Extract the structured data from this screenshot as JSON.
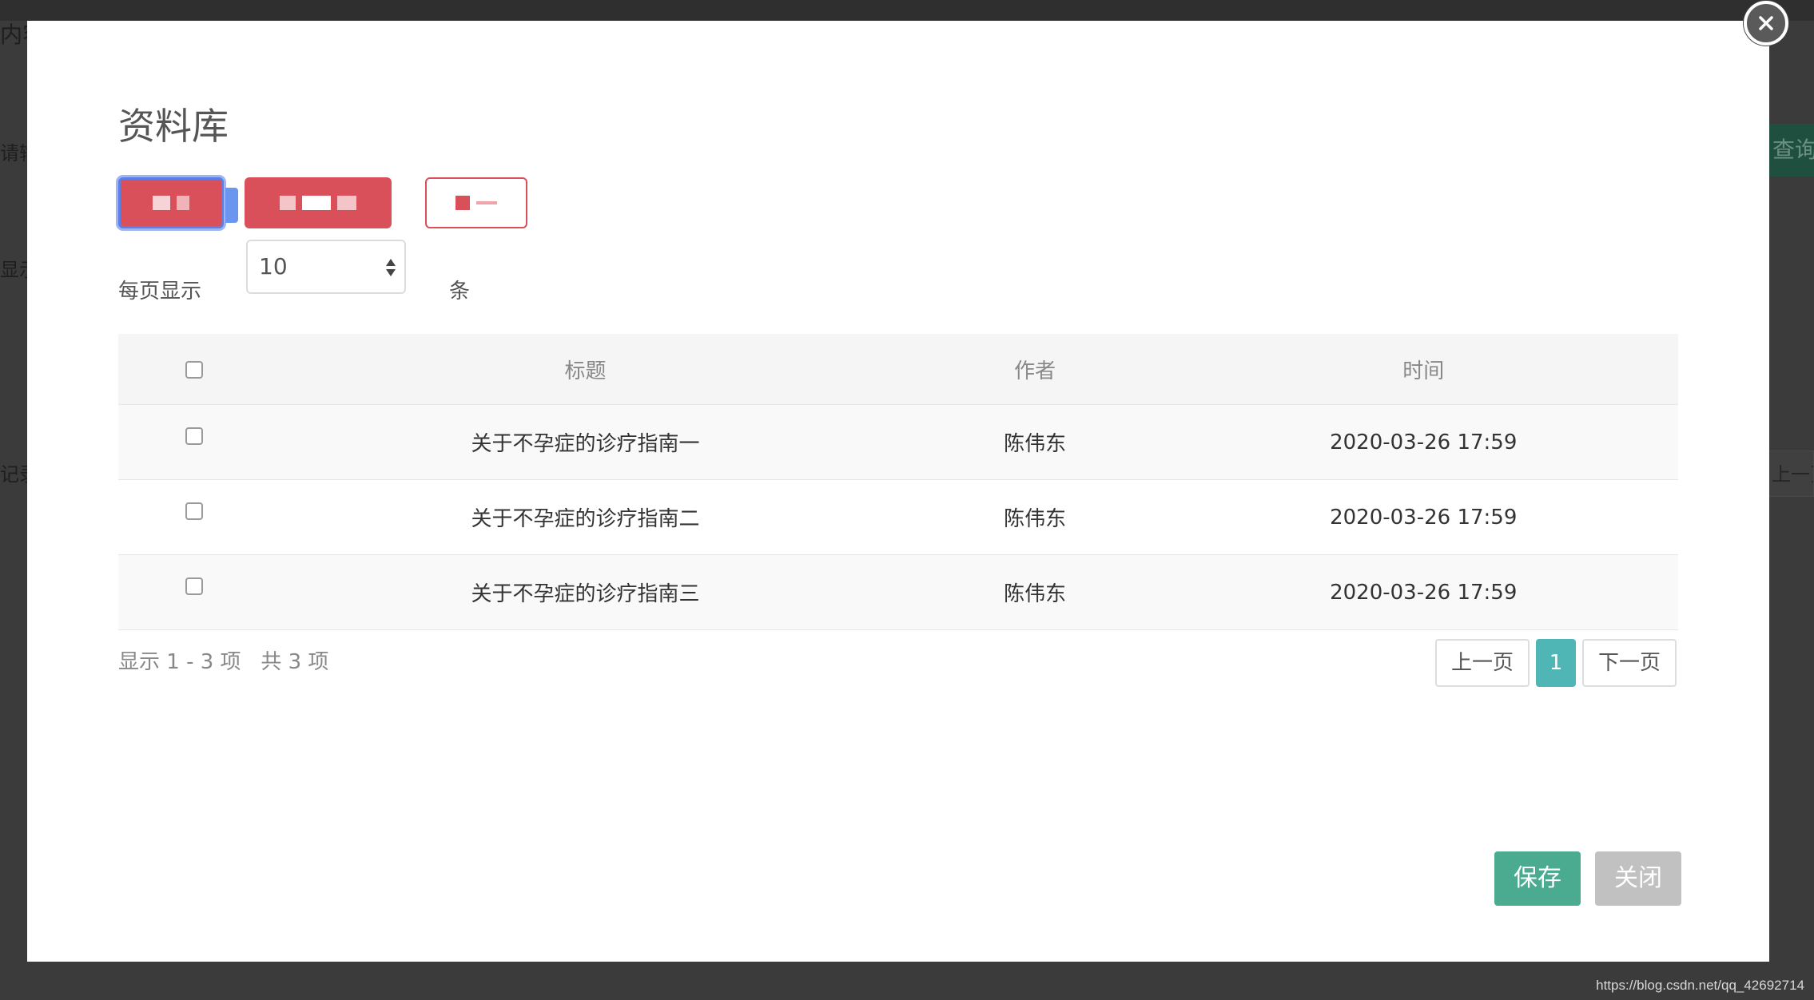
{
  "background": {
    "fragments": [
      "内容管",
      "请输",
      "显示",
      "记录"
    ],
    "query_label": "查询",
    "prev_label": "上一页"
  },
  "watermark": "https://blog.csdn.net/qq_42692714",
  "modal": {
    "title": "资料库",
    "page_size": {
      "prefix": "每页显示",
      "value": "10",
      "suffix": "条"
    },
    "table": {
      "headers": [
        "标题",
        "作者",
        "时间"
      ],
      "rows": [
        {
          "title": "关于不孕症的诊疗指南一",
          "author": "陈伟东",
          "time": "2020-03-26 17:59"
        },
        {
          "title": "关于不孕症的诊疗指南二",
          "author": "陈伟东",
          "time": "2020-03-26 17:59"
        },
        {
          "title": "关于不孕症的诊疗指南三",
          "author": "陈伟东",
          "time": "2020-03-26 17:59"
        }
      ]
    },
    "record_info": "显示 1 - 3 项   共 3 项",
    "pagination": {
      "prev": "上一页",
      "current": "1",
      "next": "下一页"
    },
    "footer": {
      "save": "保存",
      "close": "关闭"
    }
  },
  "colors": {
    "accent_red": "#d9505a",
    "save_green": "#4aab91",
    "page_active": "#4fb5b5",
    "close_gray": "#c1c1c1"
  }
}
